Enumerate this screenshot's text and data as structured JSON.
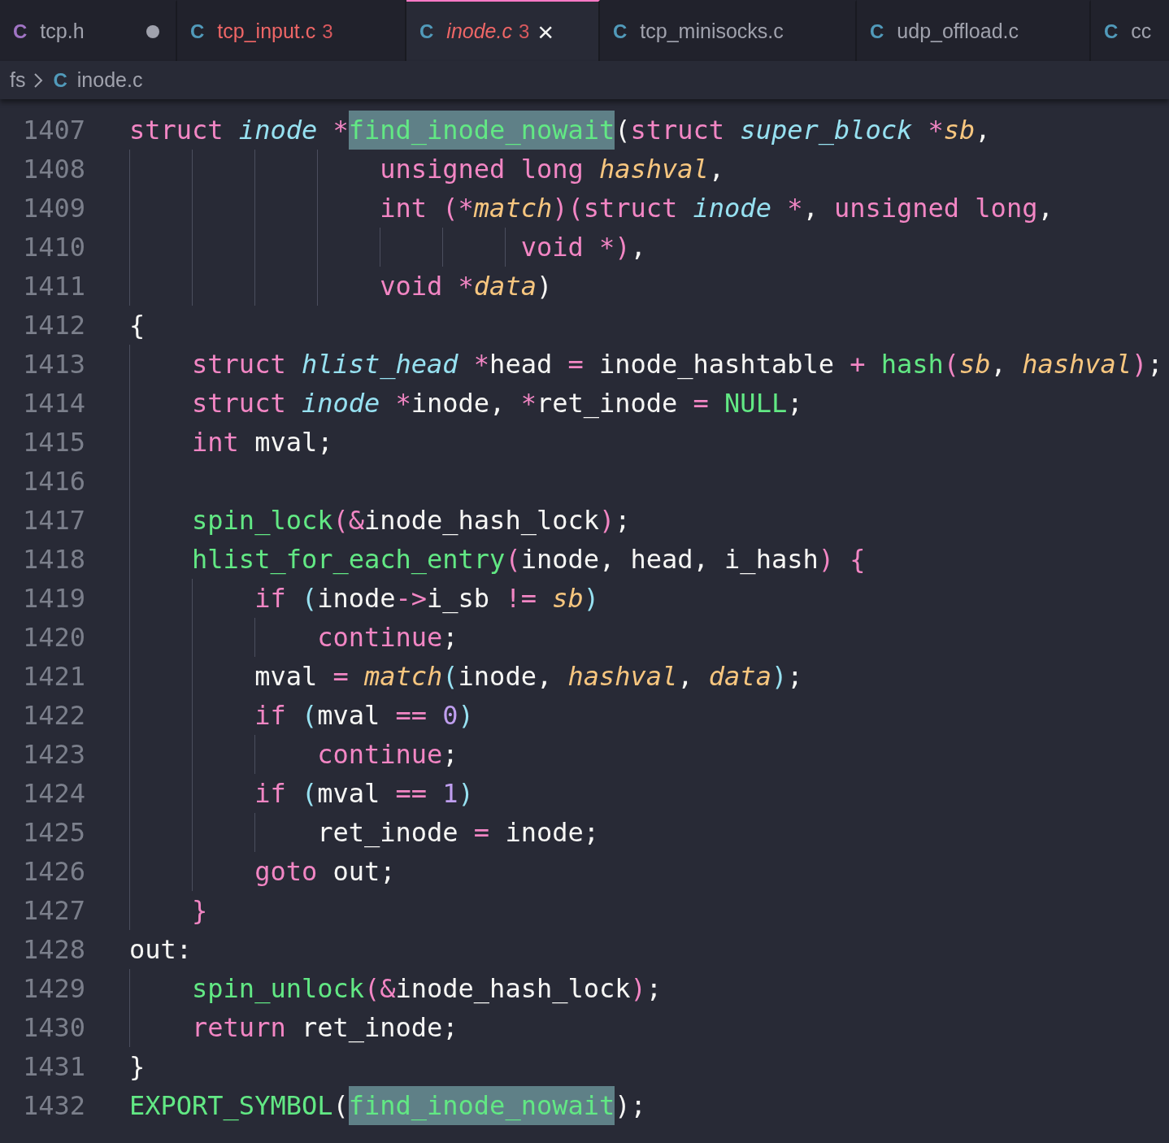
{
  "tabs": [
    {
      "icon": "C",
      "color": "#a074c4",
      "label": "tcp.h",
      "kind": "normal",
      "modified": true,
      "selected": false
    },
    {
      "icon": "C",
      "color": "#519aba",
      "label": "tcp_input.c",
      "kind": "error",
      "problems": "3",
      "selected": false
    },
    {
      "icon": "C",
      "color": "#519aba",
      "label": "inode.c",
      "kind": "error",
      "problems": "3",
      "close": "×",
      "selected": true
    },
    {
      "icon": "C",
      "color": "#519aba",
      "label": "tcp_minisocks.c",
      "kind": "normal",
      "selected": false
    },
    {
      "icon": "C",
      "color": "#519aba",
      "label": "udp_offload.c",
      "kind": "normal",
      "selected": false
    },
    {
      "icon": "C",
      "color": "#519aba",
      "label": "cc",
      "kind": "normal",
      "selected": false
    }
  ],
  "breadcrumb": {
    "folder": "fs",
    "icon": "C",
    "file": "inode.c"
  },
  "code": [
    {
      "n": "1407",
      "tokens": [
        {
          "kind": "kw",
          "t": "struct "
        },
        {
          "kind": "type",
          "t": "inode"
        },
        {
          "kind": "op",
          "t": " *"
        },
        {
          "kind": "hl",
          "t": "find_inode_nowait"
        },
        {
          "kind": "plain",
          "t": "("
        },
        {
          "kind": "kw",
          "t": "struct "
        },
        {
          "kind": "type",
          "t": "super_block"
        },
        {
          "kind": "op",
          "t": " *"
        },
        {
          "kind": "param",
          "t": "sb"
        },
        {
          "kind": "plain",
          "t": ","
        }
      ]
    },
    {
      "n": "1408",
      "tokens": [
        {
          "kind": "kw",
          "t": "                unsigned long "
        },
        {
          "kind": "param",
          "t": "hashval"
        },
        {
          "kind": "plain",
          "t": ","
        }
      ]
    },
    {
      "n": "1409",
      "tokens": [
        {
          "kind": "kw",
          "t": "                int "
        },
        {
          "kind": "b1",
          "t": "("
        },
        {
          "kind": "op",
          "t": "*"
        },
        {
          "kind": "param",
          "t": "match"
        },
        {
          "kind": "b1",
          "t": ")("
        },
        {
          "kind": "kw",
          "t": "struct "
        },
        {
          "kind": "type",
          "t": "inode"
        },
        {
          "kind": "op",
          "t": " *"
        },
        {
          "kind": "plain",
          "t": ", "
        },
        {
          "kind": "kw",
          "t": "unsigned long"
        },
        {
          "kind": "plain",
          "t": ","
        }
      ]
    },
    {
      "n": "1410",
      "tokens": [
        {
          "kind": "kw",
          "t": "                         void "
        },
        {
          "kind": "op",
          "t": "*"
        },
        {
          "kind": "b1",
          "t": ")"
        },
        {
          "kind": "plain",
          "t": ","
        }
      ]
    },
    {
      "n": "1411",
      "tokens": [
        {
          "kind": "kw",
          "t": "                void "
        },
        {
          "kind": "op",
          "t": "*"
        },
        {
          "kind": "param",
          "t": "data"
        },
        {
          "kind": "plain",
          "t": ")"
        }
      ]
    },
    {
      "n": "1412",
      "tokens": [
        {
          "kind": "plain",
          "t": "{"
        }
      ]
    },
    {
      "n": "1413",
      "tokens": [
        {
          "kind": "kw",
          "t": "    struct "
        },
        {
          "kind": "type",
          "t": "hlist_head"
        },
        {
          "kind": "op",
          "t": " *"
        },
        {
          "kind": "plain",
          "t": "head "
        },
        {
          "kind": "op",
          "t": "="
        },
        {
          "kind": "plain",
          "t": " inode_hashtable "
        },
        {
          "kind": "op",
          "t": "+"
        },
        {
          "kind": "fn",
          "t": " hash"
        },
        {
          "kind": "b1",
          "t": "("
        },
        {
          "kind": "param",
          "t": "sb"
        },
        {
          "kind": "plain",
          "t": ", "
        },
        {
          "kind": "param",
          "t": "hashval"
        },
        {
          "kind": "b1",
          "t": ")"
        },
        {
          "kind": "plain",
          "t": ";"
        }
      ]
    },
    {
      "n": "1414",
      "tokens": [
        {
          "kind": "kw",
          "t": "    struct "
        },
        {
          "kind": "type",
          "t": "inode"
        },
        {
          "kind": "op",
          "t": " *"
        },
        {
          "kind": "plain",
          "t": "inode, "
        },
        {
          "kind": "op",
          "t": "*"
        },
        {
          "kind": "plain",
          "t": "ret_inode "
        },
        {
          "kind": "op",
          "t": "="
        },
        {
          "kind": "fn",
          "t": " NULL"
        },
        {
          "kind": "plain",
          "t": ";"
        }
      ]
    },
    {
      "n": "1415",
      "tokens": [
        {
          "kind": "kw",
          "t": "    int "
        },
        {
          "kind": "plain",
          "t": "mval;"
        }
      ]
    },
    {
      "n": "1416"
    },
    {
      "n": "1417",
      "tokens": [
        {
          "kind": "fn",
          "t": "    spin_lock"
        },
        {
          "kind": "b1",
          "t": "("
        },
        {
          "kind": "op",
          "t": "&"
        },
        {
          "kind": "plain",
          "t": "inode_hash_lock"
        },
        {
          "kind": "b1",
          "t": ")"
        },
        {
          "kind": "plain",
          "t": ";"
        }
      ]
    },
    {
      "n": "1418",
      "tokens": [
        {
          "kind": "fn",
          "t": "    hlist_for_each_entry"
        },
        {
          "kind": "b1",
          "t": "("
        },
        {
          "kind": "plain",
          "t": "inode, head, i_hash"
        },
        {
          "kind": "b1",
          "t": ") {"
        }
      ]
    },
    {
      "n": "1419",
      "tokens": [
        {
          "kind": "kw",
          "t": "        if "
        },
        {
          "kind": "b2",
          "t": "("
        },
        {
          "kind": "plain",
          "t": "inode"
        },
        {
          "kind": "op",
          "t": "->"
        },
        {
          "kind": "plain",
          "t": "i_sb "
        },
        {
          "kind": "op",
          "t": "!="
        },
        {
          "kind": "param",
          "t": " sb"
        },
        {
          "kind": "b2",
          "t": ")"
        }
      ]
    },
    {
      "n": "1420",
      "tokens": [
        {
          "kind": "kw",
          "t": "            continue"
        },
        {
          "kind": "plain",
          "t": ";"
        }
      ]
    },
    {
      "n": "1421",
      "tokens": [
        {
          "kind": "plain",
          "t": "        mval "
        },
        {
          "kind": "op",
          "t": "="
        },
        {
          "kind": "param",
          "t": " match"
        },
        {
          "kind": "b2",
          "t": "("
        },
        {
          "kind": "plain",
          "t": "inode, "
        },
        {
          "kind": "param",
          "t": "hashval"
        },
        {
          "kind": "plain",
          "t": ", "
        },
        {
          "kind": "param",
          "t": "data"
        },
        {
          "kind": "b2",
          "t": ")"
        },
        {
          "kind": "plain",
          "t": ";"
        }
      ]
    },
    {
      "n": "1422",
      "tokens": [
        {
          "kind": "kw",
          "t": "        if "
        },
        {
          "kind": "b2",
          "t": "("
        },
        {
          "kind": "plain",
          "t": "mval "
        },
        {
          "kind": "op",
          "t": "=="
        },
        {
          "kind": "num",
          "t": " 0"
        },
        {
          "kind": "b2",
          "t": ")"
        }
      ]
    },
    {
      "n": "1423",
      "tokens": [
        {
          "kind": "kw",
          "t": "            continue"
        },
        {
          "kind": "plain",
          "t": ";"
        }
      ]
    },
    {
      "n": "1424",
      "tokens": [
        {
          "kind": "kw",
          "t": "        if "
        },
        {
          "kind": "b2",
          "t": "("
        },
        {
          "kind": "plain",
          "t": "mval "
        },
        {
          "kind": "op",
          "t": "=="
        },
        {
          "kind": "num",
          "t": " 1"
        },
        {
          "kind": "b2",
          "t": ")"
        }
      ]
    },
    {
      "n": "1425",
      "tokens": [
        {
          "kind": "plain",
          "t": "            ret_inode "
        },
        {
          "kind": "op",
          "t": "="
        },
        {
          "kind": "plain",
          "t": " inode;"
        }
      ]
    },
    {
      "n": "1426",
      "tokens": [
        {
          "kind": "kw",
          "t": "        goto "
        },
        {
          "kind": "plain",
          "t": "out;"
        }
      ]
    },
    {
      "n": "1427",
      "tokens": [
        {
          "kind": "b1",
          "t": "    }"
        }
      ]
    },
    {
      "n": "1428",
      "tokens": [
        {
          "kind": "plain",
          "t": "out:"
        }
      ]
    },
    {
      "n": "1429",
      "tokens": [
        {
          "kind": "fn",
          "t": "    spin_unlock"
        },
        {
          "kind": "b1",
          "t": "("
        },
        {
          "kind": "op",
          "t": "&"
        },
        {
          "kind": "plain",
          "t": "inode_hash_lock"
        },
        {
          "kind": "b1",
          "t": ")"
        },
        {
          "kind": "plain",
          "t": ";"
        }
      ]
    },
    {
      "n": "1430",
      "tokens": [
        {
          "kind": "kw",
          "t": "    return "
        },
        {
          "kind": "plain",
          "t": "ret_inode;"
        }
      ]
    },
    {
      "n": "1431",
      "tokens": [
        {
          "kind": "plain",
          "t": "}"
        }
      ]
    },
    {
      "n": "1432",
      "tokens": [
        {
          "kind": "fn",
          "t": "EXPORT_SYMBOL"
        },
        {
          "kind": "plain",
          "t": "("
        },
        {
          "kind": "hl",
          "t": "find_inode_nowait"
        },
        {
          "kind": "plain",
          "t": ");"
        }
      ]
    }
  ]
}
